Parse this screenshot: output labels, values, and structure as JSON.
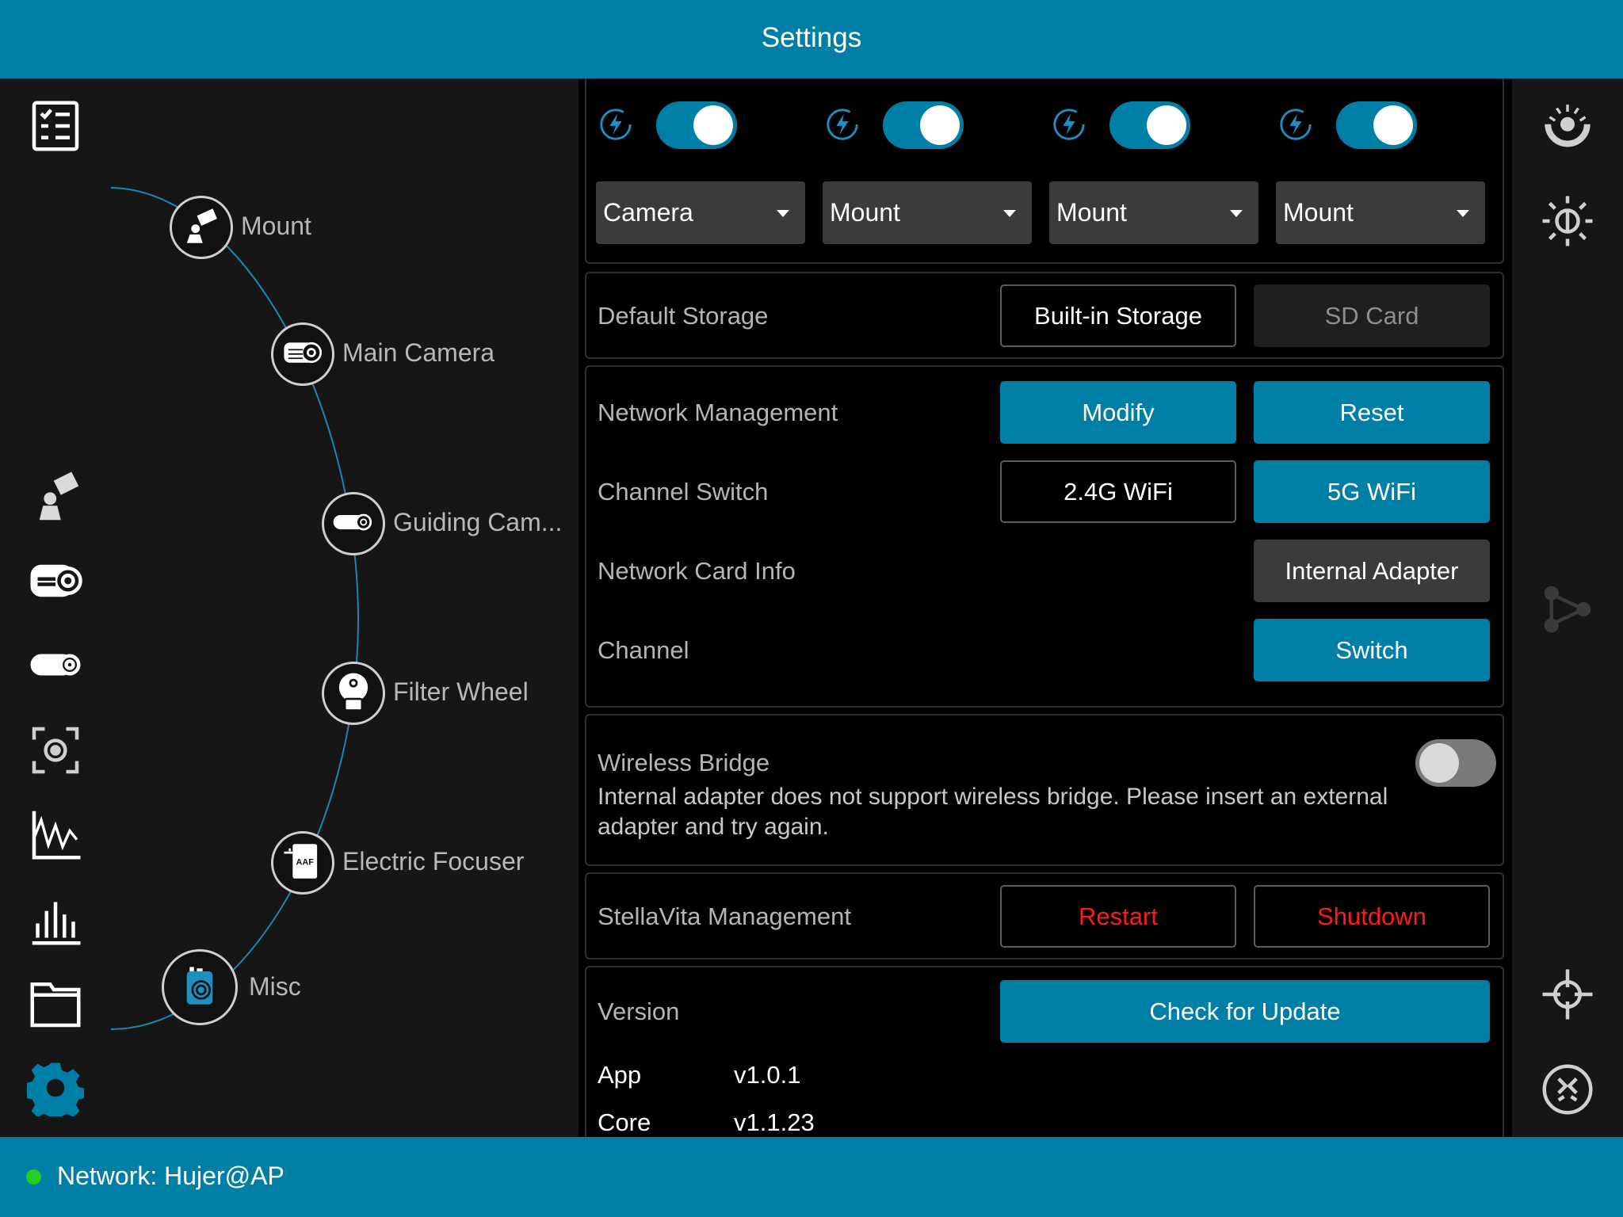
{
  "header": {
    "title": "Settings"
  },
  "footer": {
    "network_status": "Network: Hujer@AP",
    "status_color": "#23d020"
  },
  "theme": {
    "accent": "#007fa6",
    "danger": "#ff1a1a"
  },
  "left_rail": {
    "items": [
      {
        "icon": "checklist-icon"
      },
      {
        "icon": "mount-icon"
      },
      {
        "icon": "main-camera-icon"
      },
      {
        "icon": "guiding-camera-icon"
      },
      {
        "icon": "focus-target-icon"
      },
      {
        "icon": "waveform-chart-icon"
      },
      {
        "icon": "histogram-icon"
      },
      {
        "icon": "folder-icon"
      },
      {
        "icon": "gear-icon",
        "active": true
      }
    ]
  },
  "devices": {
    "items": [
      {
        "label": "Mount",
        "icon": "mount-icon"
      },
      {
        "label": "Main Camera",
        "icon": "main-camera-icon"
      },
      {
        "label": "Guiding Cam...",
        "icon": "guiding-camera-icon"
      },
      {
        "label": "Filter Wheel",
        "icon": "filter-wheel-icon"
      },
      {
        "label": "Electric Focuser",
        "icon": "focuser-icon",
        "badge": "AAF"
      },
      {
        "label": "Misc",
        "icon": "misc-device-icon"
      }
    ]
  },
  "power_ports": [
    {
      "icon": "power-icon",
      "enabled": true,
      "device": "Camera"
    },
    {
      "icon": "power-icon",
      "enabled": true,
      "device": "Mount"
    },
    {
      "icon": "power-icon",
      "enabled": true,
      "device": "Mount"
    },
    {
      "icon": "power-icon",
      "enabled": true,
      "device": "Mount"
    }
  ],
  "storage": {
    "label": "Default Storage",
    "options": [
      "Built-in Storage",
      "SD Card"
    ],
    "selected": "Built-in Storage"
  },
  "network": {
    "management_label": "Network Management",
    "modify_label": "Modify",
    "reset_label": "Reset",
    "channel_switch_label": "Channel Switch",
    "channel_options": [
      "2.4G WiFi",
      "5G WiFi"
    ],
    "channel_selected": "5G WiFi",
    "card_info_label": "Network Card Info",
    "card_info_value": "Internal Adapter",
    "channel_label": "Channel",
    "switch_label": "Switch"
  },
  "wireless_bridge": {
    "label": "Wireless Bridge",
    "enabled": false,
    "description": "Internal adapter does not support wireless bridge. Please insert an external adapter and try again."
  },
  "management": {
    "label": "StellaVita Management",
    "restart_label": "Restart",
    "shutdown_label": "Shutdown"
  },
  "version": {
    "label": "Version",
    "check_update_label": "Check for Update",
    "items": [
      {
        "name": "App",
        "value": "v1.0.1"
      },
      {
        "name": "Core",
        "value": "v1.1.23"
      }
    ]
  },
  "right_rail": {
    "items": [
      {
        "icon": "dial-icon"
      },
      {
        "icon": "brightness-icon"
      },
      {
        "icon": "connect-nodes-icon",
        "disabled": true
      },
      {
        "icon": "crosshair-icon"
      },
      {
        "icon": "collapse-icon"
      }
    ]
  }
}
